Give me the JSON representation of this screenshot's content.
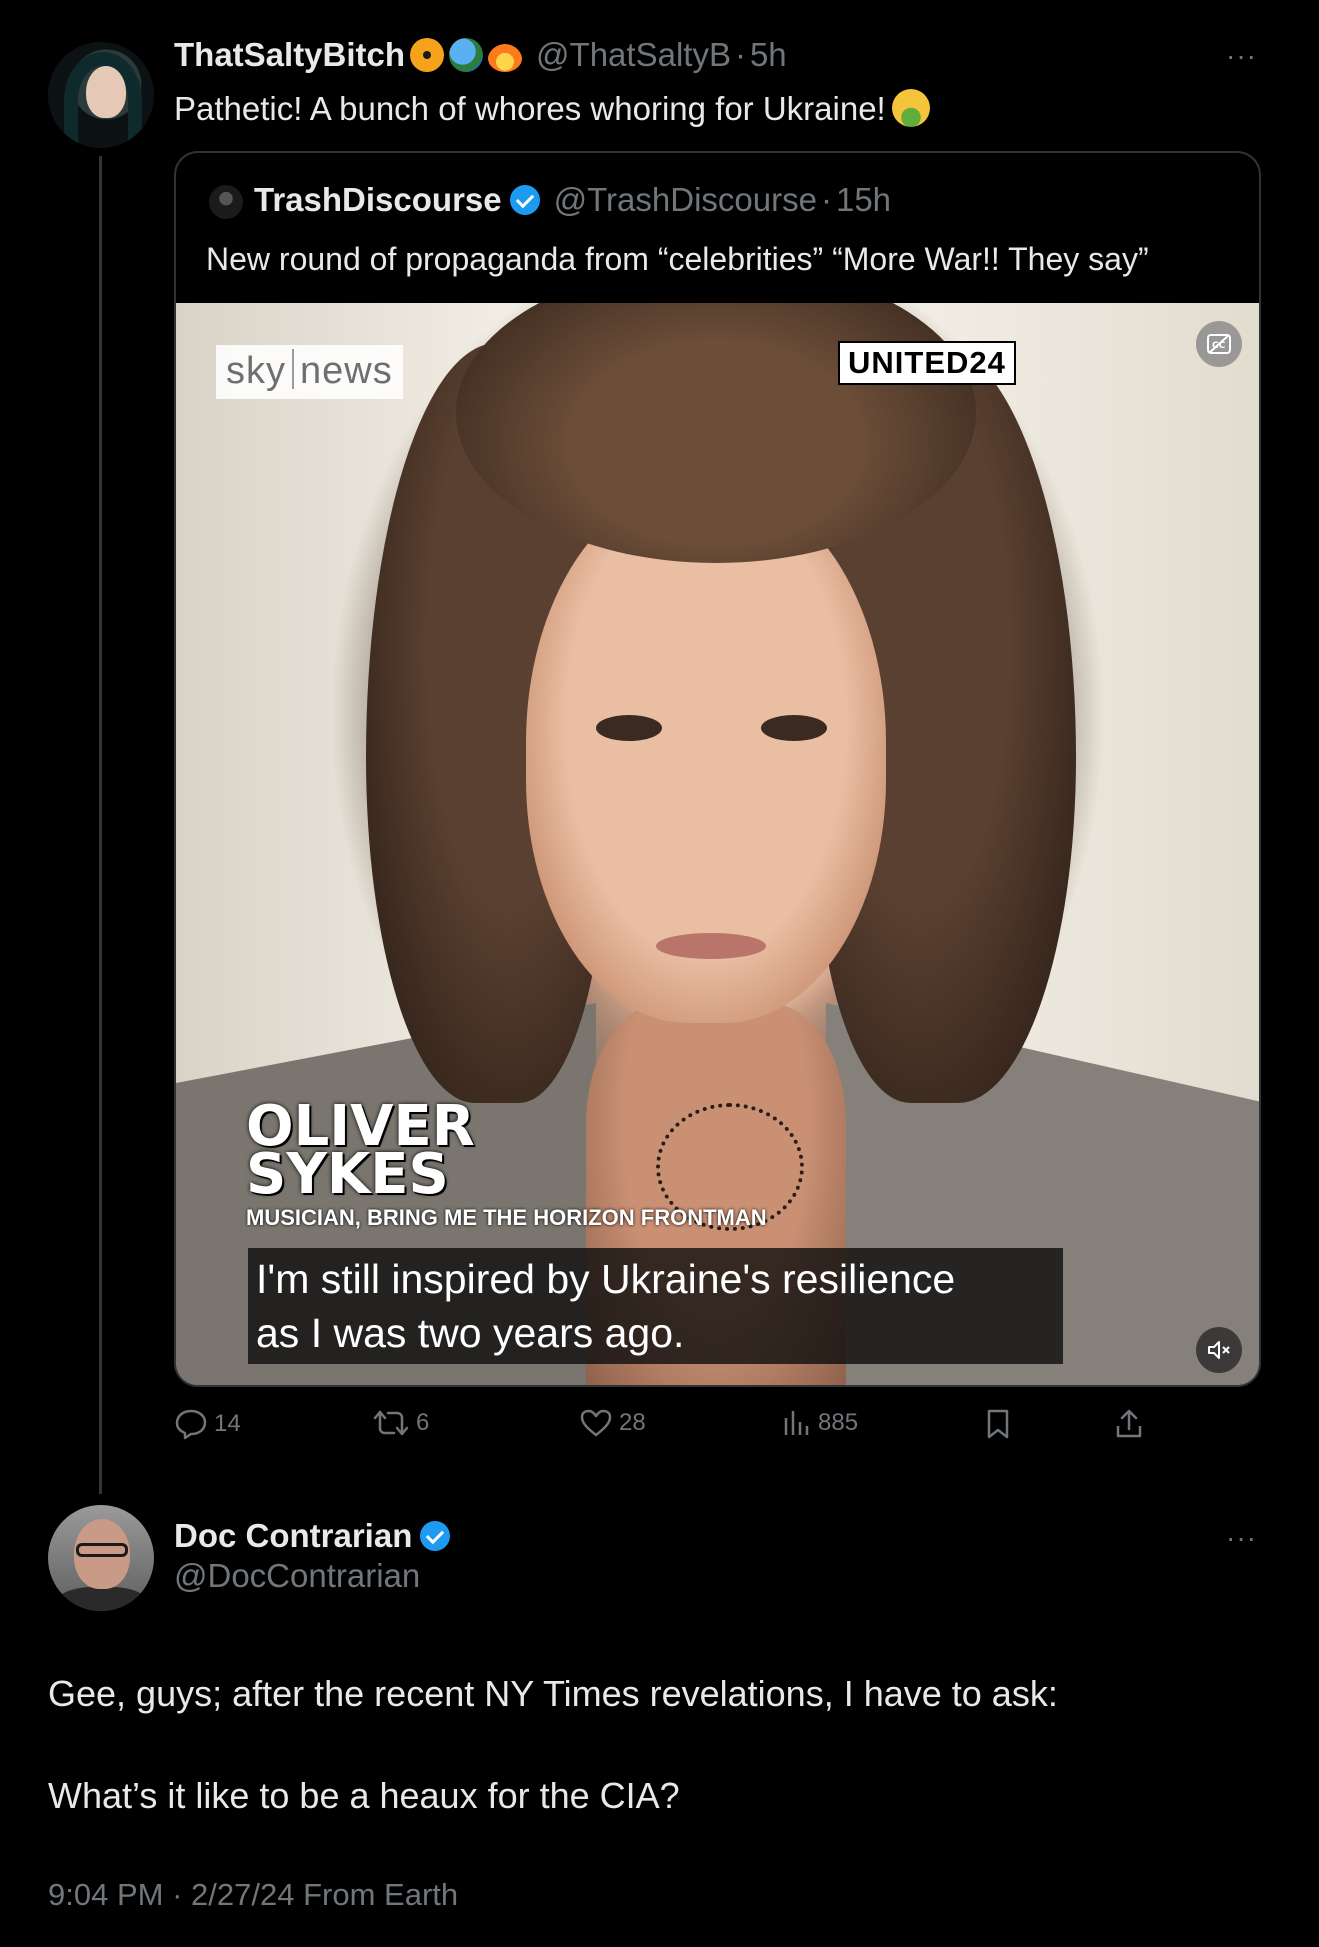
{
  "main_tweet": {
    "display_name": "ThatSaltyBitch",
    "badges": [
      "radioactive-icon",
      "globe-icon",
      "fire-icon"
    ],
    "handle": "@ThatSaltyB",
    "separator": "·",
    "time": "5h",
    "text": "Pathetic! A bunch of whores whoring for Ukraine!",
    "trailing_emoji": "nauseated-face-icon",
    "more": "···"
  },
  "quoted_tweet": {
    "display_name": "TrashDiscourse",
    "verified": true,
    "handle": "@TrashDiscourse",
    "separator": "·",
    "time": "15h",
    "text": "New round of propaganda from “celebrities” “More War!! They say”",
    "video": {
      "logo_sky": "sky",
      "logo_news": "news",
      "logo_united": "UNITED24",
      "name_caption": "OLIVER\nSYKES",
      "role_caption": "MUSICIAN, BRING ME THE HORIZON FRONTMAN",
      "subtitle_line_1": "I'm still inspired by Ukraine's resilience",
      "subtitle_line_2": "as I was two years ago."
    }
  },
  "actions": {
    "replies": "14",
    "reposts": "6",
    "likes": "28",
    "views": "885"
  },
  "reply_tweet": {
    "display_name": "Doc Contrarian",
    "verified": true,
    "handle": "@DocContrarian",
    "more": "···",
    "text_line_1": "Gee, guys; after the recent NY Times revelations, I have to ask:",
    "text_line_2": "What’s it like to be a heaux for the CIA?",
    "time": "9:04 PM",
    "separator": "·",
    "date": "2/27/24",
    "source": "From Earth"
  },
  "colors": {
    "background": "#000000",
    "text_primary": "#e7e9ea",
    "text_secondary": "#71767b",
    "verified_blue": "#1d9bf0",
    "border": "#2f3336"
  }
}
